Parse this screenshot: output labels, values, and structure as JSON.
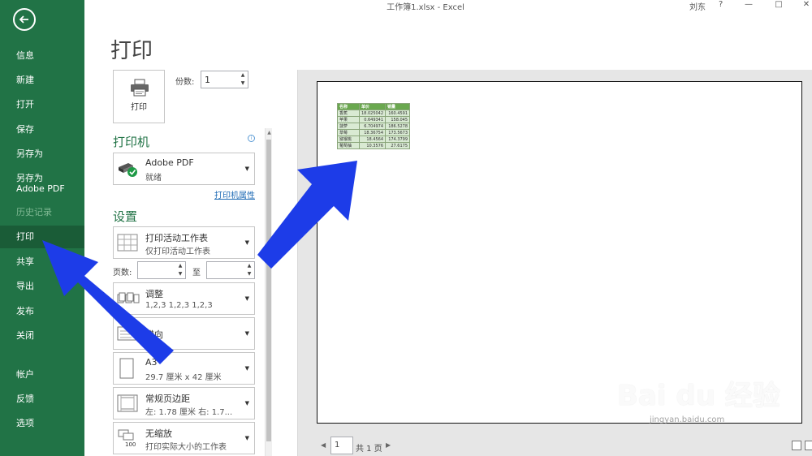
{
  "titlebar": {
    "title": "工作簿1.xlsx - Excel",
    "user": "刘东",
    "help": "?",
    "minimize": "—",
    "restore": "□",
    "close": "✕"
  },
  "sidebar": {
    "back_icon": "back-arrow-icon",
    "items": [
      {
        "label": "信息",
        "state": "normal"
      },
      {
        "label": "新建",
        "state": "normal"
      },
      {
        "label": "打开",
        "state": "normal"
      },
      {
        "label": "保存",
        "state": "normal"
      },
      {
        "label": "另存为",
        "state": "normal"
      },
      {
        "label": "另存为 Adobe PDF",
        "state": "normal"
      },
      {
        "label": "历史记录",
        "state": "disabled"
      },
      {
        "label": "打印",
        "state": "active"
      },
      {
        "label": "共享",
        "state": "normal"
      },
      {
        "label": "导出",
        "state": "normal"
      },
      {
        "label": "发布",
        "state": "normal"
      },
      {
        "label": "关闭",
        "state": "normal"
      },
      {
        "label": "帐户",
        "state": "normal"
      },
      {
        "label": "反馈",
        "state": "normal"
      },
      {
        "label": "选项",
        "state": "normal"
      }
    ]
  },
  "print": {
    "page_title": "打印",
    "print_button": "打印",
    "copies_label": "份数:",
    "copies_value": "1",
    "printer_section": "打印机",
    "printer_name": "Adobe PDF",
    "printer_status": "就绪",
    "printer_properties": "打印机属性",
    "settings_section": "设置",
    "settings": {
      "scope_main": "打印活动工作表",
      "scope_sub": "仅打印活动工作表",
      "pages_label": "页数:",
      "pages_from": "",
      "to_label": "至",
      "pages_to": "",
      "collate_main": "调整",
      "collate_sub": "1,2,3    1,2,3    1,2,3",
      "orientation_main": "横向",
      "paper_main": "A3",
      "paper_sub": "29.7 厘米 x 42 厘米",
      "margins_main": "常规页边距",
      "margins_sub": "左: 1.78 厘米    右: 1.7...",
      "scaling_main": "无缩放",
      "scaling_sub": "打印实际大小的工作表"
    }
  },
  "preview": {
    "table": {
      "headers": [
        "名称",
        "单价",
        "销量"
      ],
      "rows": [
        [
          "香蕉",
          "18.025042",
          "160.4591"
        ],
        [
          "苹果",
          "0.649341",
          "158.045"
        ],
        [
          "菠萝",
          "6.704974",
          "186.5278"
        ],
        [
          "草莓",
          "18.36754",
          "173.5673"
        ],
        [
          "猕猴桃",
          "18.4564",
          "174.3799"
        ],
        [
          "葡萄柚",
          "10.3576",
          "27.6175"
        ]
      ],
      "header_color": "#6aa84f",
      "cell_color": "#d9ead3"
    },
    "pager": {
      "current_page": "1",
      "total": "共 1 页"
    }
  },
  "annotation_color": "#1d3ce8",
  "watermark": {
    "brand": "Bai du 经验",
    "url": "jingyan.baidu.com"
  }
}
